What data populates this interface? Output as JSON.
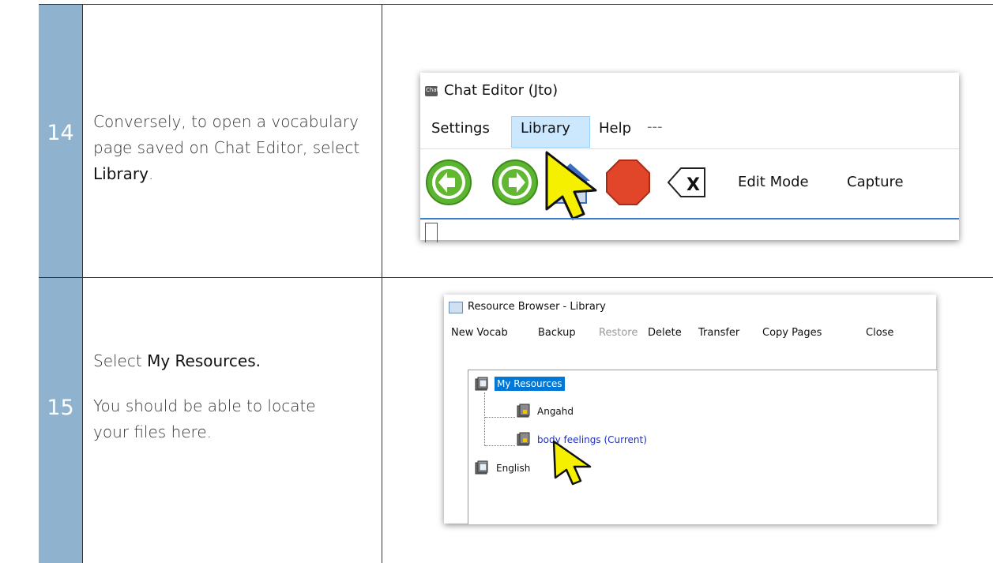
{
  "steps": [
    {
      "number": "14",
      "text_before": "Conversely, to open a vocabulary page saved on Chat Editor, select ",
      "text_bold": "Library",
      "text_after": "."
    },
    {
      "number": "15",
      "line1_before": "Select ",
      "line1_bold": "My Resources.",
      "line2": "You should be able to locate your files here."
    }
  ],
  "chat_editor": {
    "app_icon": "Chat",
    "title": "Chat Editor (Jto)",
    "menu": [
      "Settings",
      "Library",
      "Help",
      "---"
    ],
    "toolbar": {
      "edit_mode": "Edit Mode",
      "capture": "Capture",
      "backspace_glyph": "X"
    },
    "icons": [
      "back-arrow-icon",
      "forward-arrow-icon",
      "home-icon",
      "stop-icon",
      "backspace-icon",
      "pointer-cursor-icon"
    ]
  },
  "resource_browser": {
    "title": "Resource Browser - Library",
    "menu": [
      "New Vocab",
      "Backup",
      "Restore",
      "Delete",
      "Transfer",
      "Copy Pages",
      "Close"
    ],
    "tree": [
      {
        "label": "My Resources",
        "selected": true
      },
      {
        "label": "Angahd"
      },
      {
        "label": "body feelings (Current)",
        "current": true
      },
      {
        "label": "English"
      }
    ],
    "colors": {
      "selection": "#0078d7",
      "current_text": "#1e2fbf",
      "disabled": "#999999"
    }
  }
}
